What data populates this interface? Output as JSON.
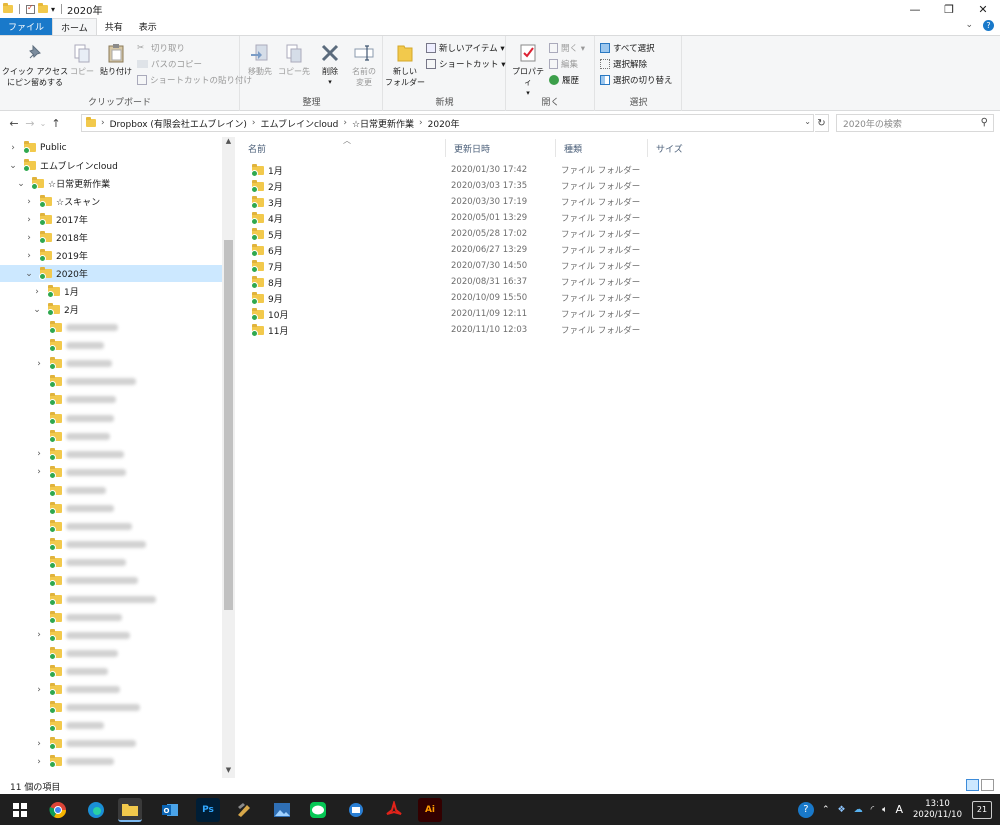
{
  "window": {
    "title": "2020年",
    "controls": [
      "—",
      "❐",
      "✕"
    ]
  },
  "tabs": {
    "file": "ファイル",
    "home": "ホーム",
    "share": "共有",
    "view": "表示"
  },
  "ribbon": {
    "clipboard": {
      "label": "クリップボード",
      "pin": "クイック アクセス\nにピン留めする",
      "copy": "コピー",
      "paste": "貼り付け",
      "cut": "切り取り",
      "copy_path": "パスのコピー",
      "paste_shortcut": "ショートカットの貼り付け"
    },
    "organize": {
      "label": "整理",
      "move_to": "移動先",
      "copy_to": "コピー先",
      "delete": "削除",
      "rename": "名前の\n変更"
    },
    "new": {
      "label": "新規",
      "new_folder": "新しい\nフォルダー",
      "new_item": "新しいアイテム ▾",
      "shortcut": "ショートカット ▾"
    },
    "open": {
      "label": "開く",
      "properties": "プロパティ",
      "open": "開く ▾",
      "edit": "編集",
      "history": "履歴"
    },
    "select": {
      "label": "選択",
      "select_all": "すべて選択",
      "select_none": "選択解除",
      "invert": "選択の切り替え"
    }
  },
  "address": {
    "crumbs": [
      "Dropbox (有限会社エムブレイン)",
      "エムブレインcloud",
      "☆日常更新作業",
      "2020年"
    ],
    "search_placeholder": "2020年の検索"
  },
  "nav_tree": [
    {
      "label": "Public",
      "chevron": "›"
    },
    {
      "label": "エムブレインcloud",
      "chevron": "⌄"
    },
    {
      "label": "☆日常更新作業",
      "chevron": "⌄"
    },
    {
      "label": "☆スキャン",
      "chevron": "›"
    },
    {
      "label": "2017年",
      "chevron": "›"
    },
    {
      "label": "2018年",
      "chevron": "›"
    },
    {
      "label": "2019年",
      "chevron": "›"
    },
    {
      "label": "2020年",
      "chevron": "⌄"
    },
    {
      "label": "1月",
      "chevron": "›"
    },
    {
      "label": "2月",
      "chevron": "⌄"
    }
  ],
  "columns": {
    "name": "名前",
    "date": "更新日時",
    "type": "種類",
    "size": "サイズ"
  },
  "files": [
    {
      "name": "1月",
      "date": "2020/01/30 17:42",
      "type": "ファイル フォルダー"
    },
    {
      "name": "2月",
      "date": "2020/03/03 17:35",
      "type": "ファイル フォルダー"
    },
    {
      "name": "3月",
      "date": "2020/03/30 17:19",
      "type": "ファイル フォルダー"
    },
    {
      "name": "4月",
      "date": "2020/05/01 13:29",
      "type": "ファイル フォルダー"
    },
    {
      "name": "5月",
      "date": "2020/05/28 17:02",
      "type": "ファイル フォルダー"
    },
    {
      "name": "6月",
      "date": "2020/06/27 13:29",
      "type": "ファイル フォルダー"
    },
    {
      "name": "7月",
      "date": "2020/07/30 14:50",
      "type": "ファイル フォルダー"
    },
    {
      "name": "8月",
      "date": "2020/08/31 16:37",
      "type": "ファイル フォルダー"
    },
    {
      "name": "9月",
      "date": "2020/10/09 15:50",
      "type": "ファイル フォルダー"
    },
    {
      "name": "10月",
      "date": "2020/11/09 12:11",
      "type": "ファイル フォルダー"
    },
    {
      "name": "11月",
      "date": "2020/11/10 12:03",
      "type": "ファイル フォルダー"
    }
  ],
  "status": {
    "count": "11 個の項目"
  },
  "taskbar": {
    "time": "13:10",
    "date": "2020/11/10",
    "ime": "A",
    "notifications": "21",
    "apps": [
      "Ps",
      "Ai"
    ]
  },
  "colors": {
    "accent": "#1979ca",
    "selected": "#cce8ff",
    "folder": "#f2c94c",
    "sync_ok": "#2fa84f",
    "taskbar": "#1f1f1f"
  }
}
